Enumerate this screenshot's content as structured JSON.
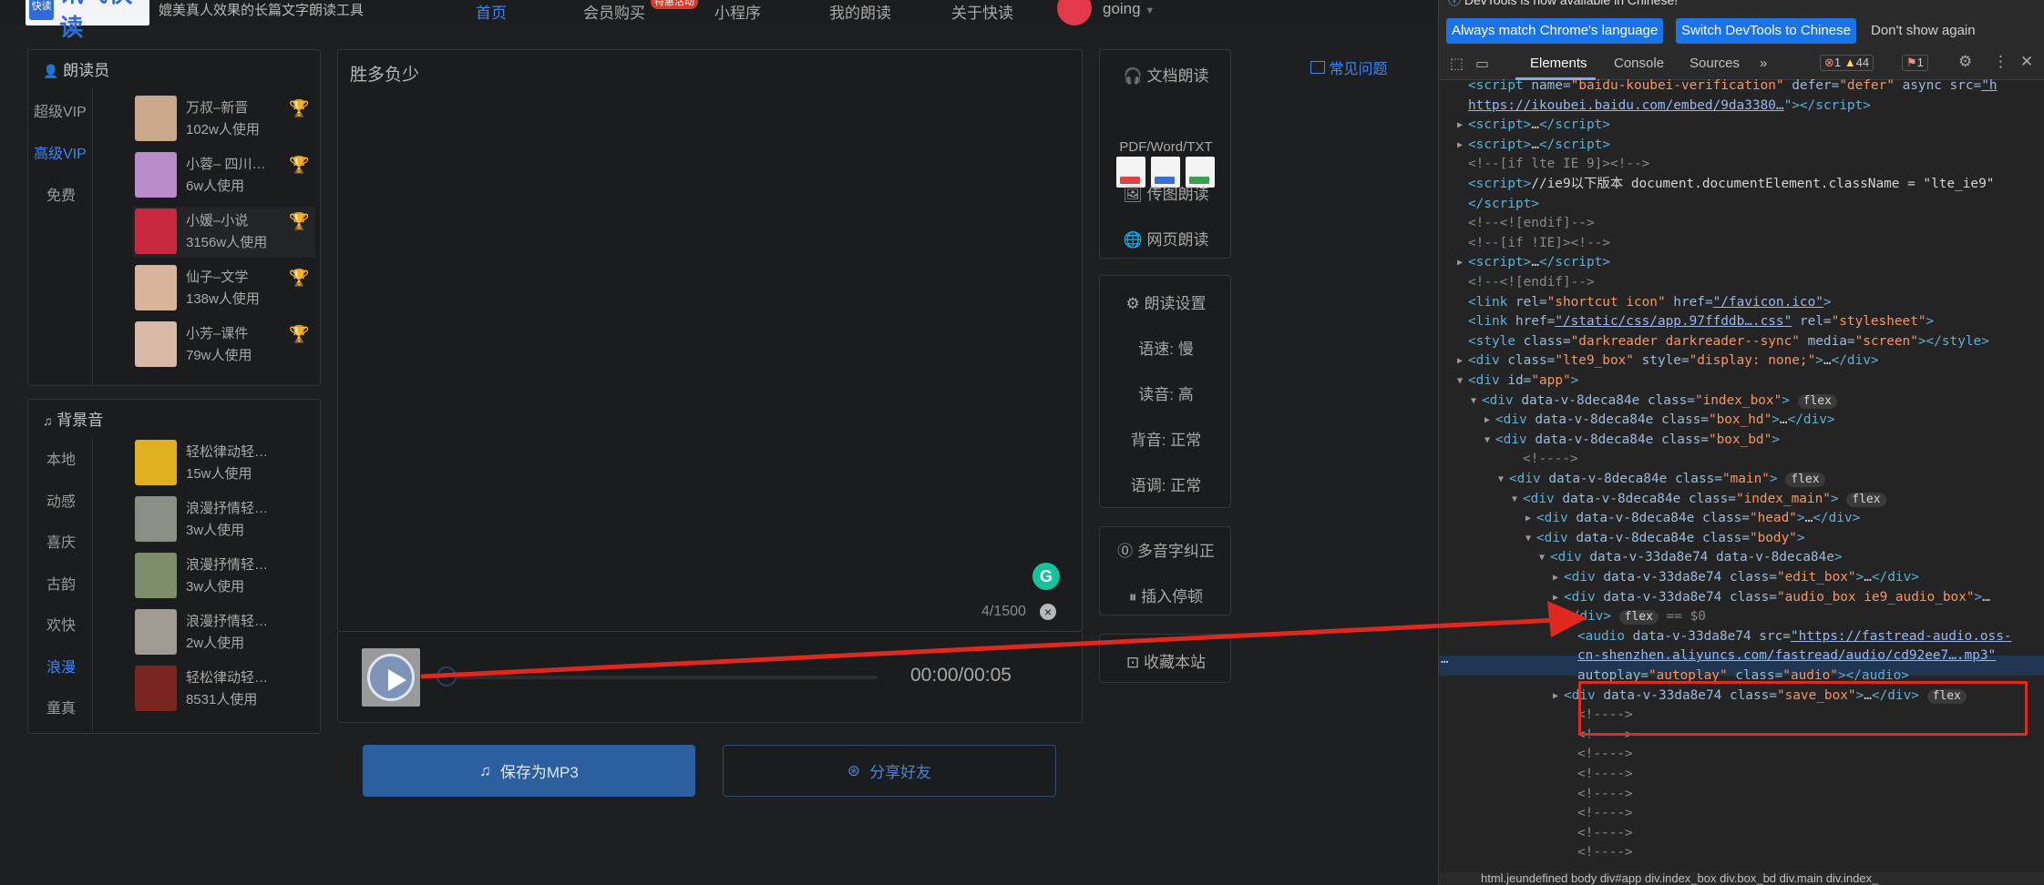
{
  "site": {
    "logo_badge": "快读",
    "logo_text": "讯飞快读",
    "slogan": "媲美真人效果的长篇文字朗读工具",
    "nav": [
      {
        "label": "首页",
        "active": true
      },
      {
        "label": "会员购买",
        "badge": "特惠活动"
      },
      {
        "label": "小程序"
      },
      {
        "label": "我的朗读"
      },
      {
        "label": "关于快读"
      }
    ],
    "username": "going",
    "faq": "常见问题"
  },
  "voices_panel": {
    "title": "朗读员",
    "tabs": [
      "超级VIP",
      "高级VIP",
      "免费"
    ],
    "active_tab": "高级VIP",
    "items": [
      {
        "name": "万叔–新晋",
        "uses": "102w人使用",
        "color": "#c9a98a"
      },
      {
        "name": "小蓉– 四川…",
        "uses": "6w人使用",
        "color": "#b98cc9"
      },
      {
        "name": "小媛–小说",
        "uses": "3156w人使用",
        "color": "#c9283e"
      },
      {
        "name": "仙子–文学",
        "uses": "138w人使用",
        "color": "#d8b49a"
      },
      {
        "name": "小芳–课件",
        "uses": "79w人使用",
        "color": "#d9b8a6"
      }
    ]
  },
  "bgm_panel": {
    "title": "背景音",
    "tabs": [
      "本地",
      "动感",
      "喜庆",
      "古韵",
      "欢快",
      "浪漫",
      "童真"
    ],
    "active_tab": "浪漫",
    "items": [
      {
        "name": "轻松律动轻…",
        "uses": "15w人使用",
        "color": "#e0b020"
      },
      {
        "name": "浪漫抒情轻…",
        "uses": "3w人使用",
        "color": "#8a8f85"
      },
      {
        "name": "浪漫抒情轻…",
        "uses": "3w人使用",
        "color": "#7d8f6a"
      },
      {
        "name": "浪漫抒情轻…",
        "uses": "2w人使用",
        "color": "#a09a90"
      },
      {
        "name": "轻松律动轻…",
        "uses": "8531人使用",
        "color": "#7a2620"
      }
    ]
  },
  "editor": {
    "text": "胜多负少",
    "counter": "4/1500",
    "grammarly_icon": "G",
    "time": "00:00/00:05",
    "save_mp3": "保存为MP3",
    "share": "分享好友"
  },
  "right_panels": {
    "doc_read": "文档朗读",
    "formats": "PDF/Word/TXT",
    "image_read": "传图朗读",
    "web_read": "网页朗读",
    "settings_title": "朗读设置",
    "settings": [
      "语速: 慢",
      "读音: 高",
      "背音: 正常",
      "语调: 正常"
    ],
    "polyphone": "多音字纠正",
    "insert_pause": "插入停顿",
    "bookmark": "收藏本站"
  },
  "devtools": {
    "banner": "DevTools is now available in Chinese!",
    "btn_match": "Always match Chrome's language",
    "btn_switch": "Switch DevTools to Chinese",
    "btn_dont": "Don't show again",
    "tabs": [
      "Elements",
      "Console",
      "Sources"
    ],
    "errors": "1",
    "warnings": "44",
    "issues": "1",
    "crumbs": "html.jeundefined   body   div#app   div.index_box   div.box_bd   div.main   div.index_",
    "lines": [
      {
        "indent": 32,
        "html": "<span class='tag'>&lt;script</span> <span class='attr'>name=</span><span class='val'>\"baidu-koubei-verification\"</span> <span class='attr'>defer=</span><span class='val'>\"defer\"</span> <span class='attr'>async src=</span><span class='link'>\"h</span>"
      },
      {
        "indent": 32,
        "html": "<span class='link'>https://ikoubei.baidu.com/embed/9da3380…</span><span class='tag'>\"&gt;&lt;/script&gt;</span>"
      },
      {
        "indent": 32,
        "tri": "▶",
        "html": "<span class='tag'>&lt;script&gt;</span><span class='txt'>…</span><span class='tag'>&lt;/script&gt;</span>"
      },
      {
        "indent": 32,
        "tri": "▶",
        "html": "<span class='tag'>&lt;script&gt;</span><span class='txt'>…</span><span class='tag'>&lt;/script&gt;</span>"
      },
      {
        "indent": 32,
        "html": "<span class='com'>&lt;!--[if lte IE 9]&gt;&lt;!--&gt;</span>"
      },
      {
        "indent": 32,
        "html": "<span class='tag'>&lt;script&gt;</span><span class='txt'>//ie9以下版本 document.documentElement.className = \"lte_ie9\"</span>"
      },
      {
        "indent": 32,
        "html": "<span class='tag'>&lt;/script&gt;</span>"
      },
      {
        "indent": 32,
        "html": "<span class='com'>&lt;!--&lt;![endif]--&gt;</span>"
      },
      {
        "indent": 32,
        "html": "<span class='com'>&lt;!--[if !IE]&gt;&lt;!--&gt;</span>"
      },
      {
        "indent": 32,
        "tri": "▶",
        "html": "<span class='tag'>&lt;script&gt;</span><span class='txt'>…</span><span class='tag'>&lt;/script&gt;</span>"
      },
      {
        "indent": 32,
        "html": "<span class='com'>&lt;!--&lt;![endif]--&gt;</span>"
      },
      {
        "indent": 32,
        "html": "<span class='tag'>&lt;link</span> <span class='attr'>rel=</span><span class='val'>\"shortcut icon\"</span> <span class='attr'>href=</span><span class='link'>\"/favicon.ico\"</span><span class='tag'>&gt;</span>"
      },
      {
        "indent": 32,
        "html": "<span class='tag'>&lt;link</span> <span class='attr'>href=</span><span class='link'>\"/static/css/app.97ffddb….css\"</span> <span class='attr'>rel=</span><span class='val'>\"stylesheet\"</span><span class='tag'>&gt;</span>"
      },
      {
        "indent": 32,
        "html": "<span class='tag'>&lt;style</span> <span class='attr'>class=</span><span class='val'>\"darkreader darkreader--sync\"</span> <span class='attr'>media=</span><span class='val'>\"screen\"</span><span class='tag'>&gt;&lt;/style&gt;</span>"
      },
      {
        "indent": 32,
        "tri": "▶",
        "html": "<span class='tag'>&lt;div</span> <span class='attr'>class=</span><span class='val'>\"lte9_box\"</span> <span class='attr'>style=</span><span class='val'>\"display: none;\"</span><span class='tag'>&gt;</span><span class='txt'>…</span><span class='tag'>&lt;/div&gt;</span>"
      },
      {
        "indent": 32,
        "tri": "▼",
        "html": "<span class='tag'>&lt;div</span> <span class='attr'>id=</span><span class='val'>\"app\"</span><span class='tag'>&gt;</span>"
      },
      {
        "indent": 47,
        "tri": "▼",
        "html": "<span class='tag'>&lt;div</span> <span class='attr'>data-v-8deca84e class=</span><span class='val'>\"index_box\"</span><span class='tag'>&gt;</span> <span class='flexb'>flex</span>"
      },
      {
        "indent": 62,
        "tri": "▶",
        "html": "<span class='tag'>&lt;div</span> <span class='attr'>data-v-8deca84e class=</span><span class='val'>\"box_hd\"</span><span class='tag'>&gt;</span><span class='txt'>…</span><span class='tag'>&lt;/div&gt;</span>"
      },
      {
        "indent": 62,
        "tri": "▼",
        "html": "<span class='tag'>&lt;div</span> <span class='attr'>data-v-8deca84e class=</span><span class='val'>\"box_bd\"</span><span class='tag'>&gt;</span>"
      },
      {
        "indent": 92,
        "html": "<span class='com'>&lt;!----&gt;</span>"
      },
      {
        "indent": 77,
        "tri": "▼",
        "html": "<span class='tag'>&lt;div</span> <span class='attr'>data-v-8deca84e class=</span><span class='val'>\"main\"</span><span class='tag'>&gt;</span> <span class='flexb'>flex</span>"
      },
      {
        "indent": 92,
        "tri": "▼",
        "html": "<span class='tag'>&lt;div</span> <span class='attr'>data-v-8deca84e class=</span><span class='val'>\"index_main\"</span><span class='tag'>&gt;</span> <span class='flexb'>flex</span>"
      },
      {
        "indent": 107,
        "tri": "▶",
        "html": "<span class='tag'>&lt;div</span> <span class='attr'>data-v-8deca84e class=</span><span class='val'>\"head\"</span><span class='tag'>&gt;</span><span class='txt'>…</span><span class='tag'>&lt;/div&gt;</span>"
      },
      {
        "indent": 107,
        "tri": "▼",
        "html": "<span class='tag'>&lt;div</span> <span class='attr'>data-v-8deca84e class=</span><span class='val'>\"body\"</span><span class='tag'>&gt;</span>"
      },
      {
        "indent": 122,
        "tri": "▼",
        "html": "<span class='tag'>&lt;div</span> <span class='attr'>data-v-33da8e74 data-v-8deca84e</span><span class='tag'>&gt;</span>"
      },
      {
        "indent": 137,
        "tri": "▶",
        "html": "<span class='tag'>&lt;div</span> <span class='attr'>data-v-33da8e74 class=</span><span class='val'>\"edit_box\"</span><span class='tag'>&gt;</span><span class='txt'>…</span><span class='tag'>&lt;/div&gt;</span>"
      },
      {
        "indent": 137,
        "tri": "▶",
        "html": "<span class='tag'>&lt;div</span> <span class='attr'>data-v-33da8e74 class=</span><span class='val'>\"audio_box ie9_audio_box\"</span><span class='tag'>&gt;</span><span class='txt'>…</span>"
      },
      {
        "indent": 137,
        "html": "<span class='tag'>&lt;/div&gt;</span> <span class='flexb'>flex</span> <span class='com'>== $0</span>"
      },
      {
        "indent": 152,
        "html": "<span class='tag'>&lt;audio</span> <span class='attr'>data-v-33da8e74 src=</span><span class='link'>\"https://fastread-audio.oss-</span>"
      },
      {
        "indent": 152,
        "html": "<span class='link'>cn-shenzhen.aliyuncs.com/fastread/audio/cd92ee7….mp3\"</span>"
      },
      {
        "indent": 152,
        "html": "<span class='attr'>autoplay=</span><span class='val'>\"autoplay\"</span> <span class='attr'>class=</span><span class='val'>\"audio\"</span><span class='tag'>&gt;&lt;/audio&gt;</span>"
      },
      {
        "indent": 137,
        "tri": "▶",
        "html": "<span class='tag'>&lt;div</span> <span class='attr'>data-v-33da8e74 class=</span><span class='val'>\"save_box\"</span><span class='tag'>&gt;</span><span class='txt'>…</span><span class='tag'>&lt;/div&gt;</span> <span class='flexb'>flex</span>"
      },
      {
        "indent": 152,
        "html": "<span class='com'>&lt;!----&gt;</span>"
      },
      {
        "indent": 152,
        "html": "<span class='com'>&lt;!----&gt;</span>"
      },
      {
        "indent": 152,
        "html": "<span class='com'>&lt;!----&gt;</span>"
      },
      {
        "indent": 152,
        "html": "<span class='com'>&lt;!----&gt;</span>"
      },
      {
        "indent": 152,
        "html": "<span class='com'>&lt;!----&gt;</span>"
      },
      {
        "indent": 152,
        "html": "<span class='com'>&lt;!----&gt;</span>"
      },
      {
        "indent": 152,
        "html": "<span class='com'>&lt;!----&gt;</span>"
      },
      {
        "indent": 152,
        "html": "<span class='com'>&lt;!----&gt;</span>"
      }
    ]
  },
  "colors": {
    "accent": "#3e85f5",
    "highlight": "#e02b20",
    "devtools_blue": "#1a73e8"
  }
}
